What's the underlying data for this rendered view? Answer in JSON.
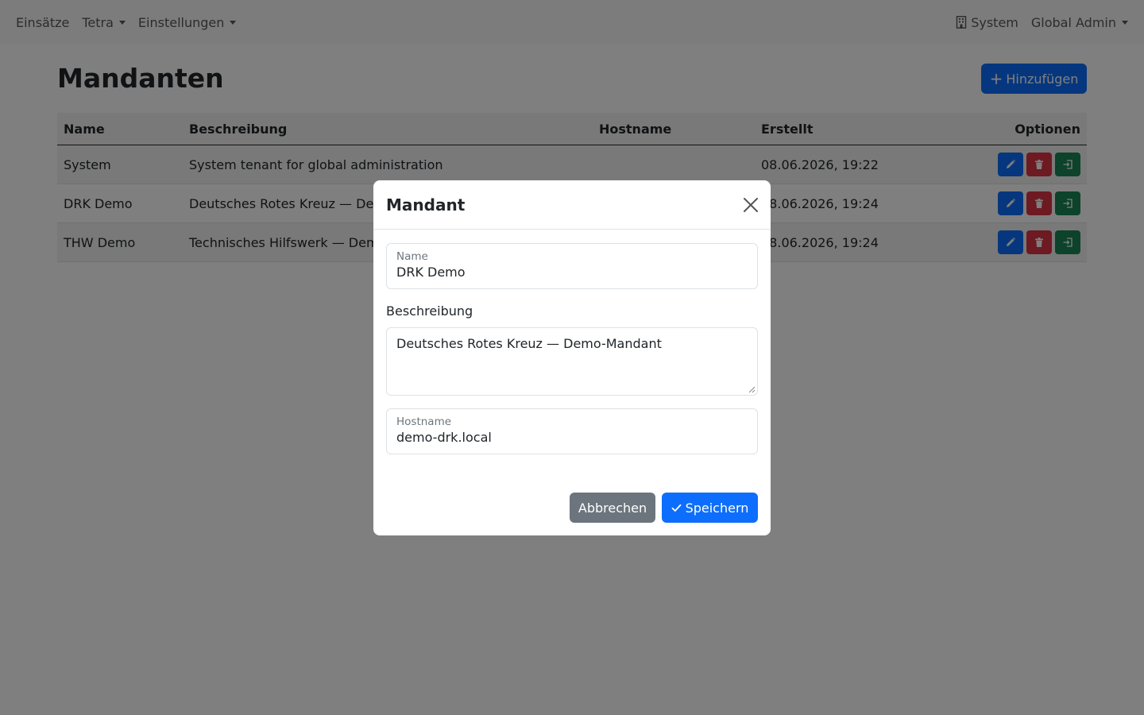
{
  "navbar": {
    "left_items": [
      {
        "label": "Einsätze"
      },
      {
        "label": "Tetra"
      },
      {
        "label": "Einstellungen"
      }
    ],
    "tenant_label": "System",
    "user_label": "Global Admin"
  },
  "page": {
    "title": "Mandanten",
    "add_button_label": "Hinzufügen"
  },
  "table": {
    "columns": [
      "Name",
      "Beschreibung",
      "Hostname",
      "Erstellt",
      "Optionen"
    ],
    "rows": [
      {
        "name": "System",
        "description": "System tenant for global administration",
        "hostname": "",
        "created": "08.06.2026, 19:22"
      },
      {
        "name": "DRK Demo",
        "description": "Deutsches Rotes Kreuz — Demo-Mandant",
        "hostname": "",
        "created": "08.06.2026, 19:24"
      },
      {
        "name": "THW Demo",
        "description": "Technisches Hilfswerk — Demo-Mandant",
        "hostname": "",
        "created": "08.06.2026, 19:24"
      }
    ]
  },
  "modal": {
    "title": "Mandant",
    "name_label": "Name",
    "name_value": "DRK Demo",
    "description_label": "Beschreibung",
    "description_value": "Deutsches Rotes Kreuz — Demo-Mandant",
    "hostname_label": "Hostname",
    "hostname_value": "demo-drk.local",
    "cancel_label": "Abbrechen",
    "save_label": "Speichern"
  },
  "colors": {
    "primary": "#0d6efd",
    "danger": "#dc3545",
    "success": "#198754",
    "secondary": "#6c757d"
  },
  "icons": [
    "building-icon",
    "plus-icon",
    "pencil-icon",
    "trash-icon",
    "login-icon",
    "close-icon",
    "check-icon"
  ]
}
